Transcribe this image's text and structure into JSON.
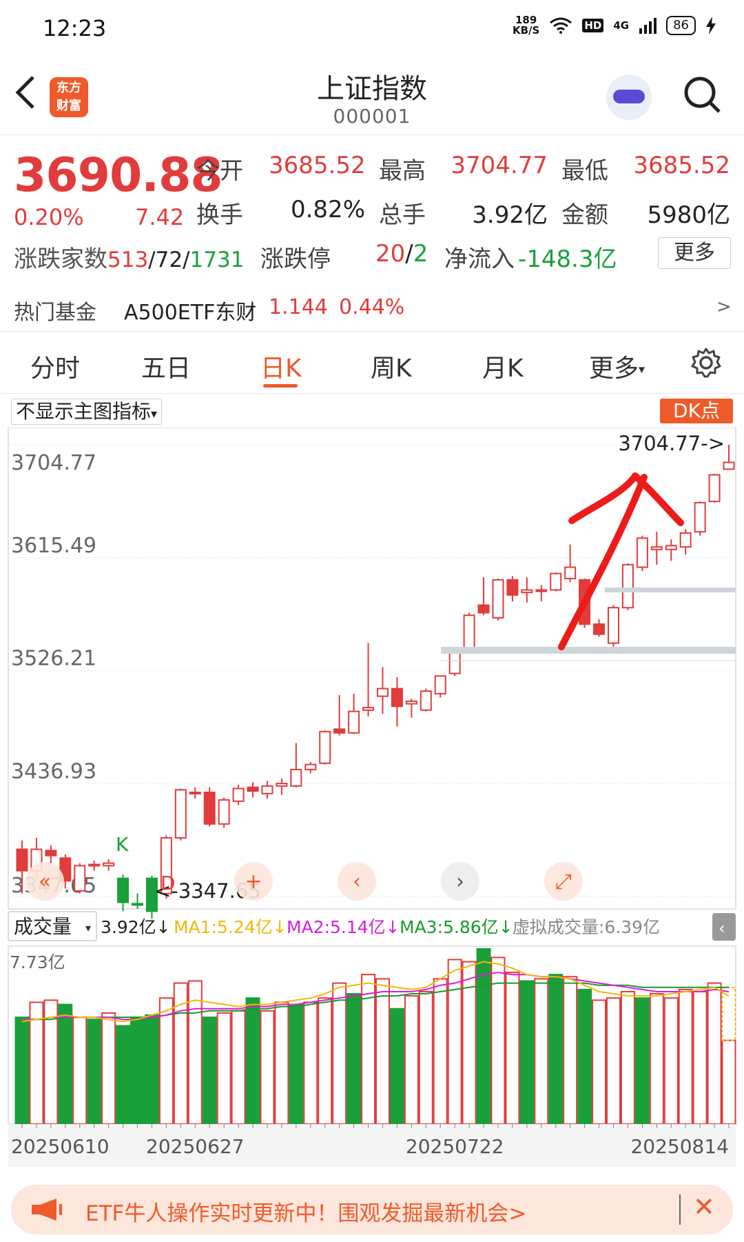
{
  "status_bar": {
    "time": "12:23",
    "speed": "189",
    "speed_unit": "KB/S",
    "hd": "HD",
    "net": "4G",
    "battery": "86"
  },
  "header": {
    "title": "上证指数",
    "code": "000001",
    "logo_line1": "东方",
    "logo_line2": "财富"
  },
  "quote": {
    "price": "3690.88",
    "change_pct": "0.20%",
    "change": "7.42",
    "rows": [
      [
        {
          "label": "今开",
          "value": "3685.52",
          "color": "red"
        },
        {
          "label": "最高",
          "value": "3704.77",
          "color": "red"
        },
        {
          "label": "最低",
          "value": "3685.52",
          "color": "red"
        }
      ],
      [
        {
          "label": "换手",
          "value": "0.82%",
          "color": "black"
        },
        {
          "label": "总手",
          "value": "3.92亿",
          "color": "black"
        },
        {
          "label": "金额",
          "value": "5980亿",
          "color": "black"
        }
      ]
    ],
    "breadth_label": "涨跌家数",
    "breadth_up": "513",
    "breadth_flat": "72",
    "breadth_down": "1731",
    "limit_label": "涨跌停",
    "limit_up": "20",
    "limit_down": "2",
    "netflow_label": "净流入",
    "netflow_value": "-148.3亿",
    "more_label": "更多"
  },
  "fund": {
    "label": "热门基金",
    "name": "A500ETF东财",
    "price": "1.144",
    "pct": "0.44%",
    "arrow": ">"
  },
  "tabs": [
    "分时",
    "五日",
    "日K",
    "周K",
    "月K",
    "更多"
  ],
  "active_tab": 2,
  "chart_toolbar": {
    "indicator_select": "不显示主图指标",
    "dk_label": "DK点"
  },
  "chart_data": [
    {
      "type": "candlestick",
      "title": "",
      "y_ticks": [
        "3704.77",
        "3615.49",
        "3526.21",
        "3436.93",
        "3347.65"
      ],
      "ylim": [
        3347.65,
        3704.77
      ],
      "high_label": "3704.77->",
      "low_label": "<-3347.65",
      "markers": [
        {
          "text": "K"
        },
        {
          "text": "D"
        }
      ],
      "candles": [
        {
          "o": 3385,
          "c": 3368,
          "h": 3392,
          "l": 3350
        },
        {
          "o": 3368,
          "c": 3385,
          "h": 3394,
          "l": 3362
        },
        {
          "o": 3384,
          "c": 3380,
          "h": 3388,
          "l": 3374
        },
        {
          "o": 3378,
          "c": 3360,
          "h": 3381,
          "l": 3354
        },
        {
          "o": 3352,
          "c": 3372,
          "h": 3374,
          "l": 3350
        },
        {
          "o": 3372,
          "c": 3373,
          "h": 3376,
          "l": 3368
        },
        {
          "o": 3372,
          "c": 3374,
          "h": 3377,
          "l": 3368
        },
        {
          "o": 3362,
          "c": 3343,
          "h": 3365,
          "l": 3336
        },
        {
          "o": 3342,
          "c": 3342,
          "h": 3350,
          "l": 3338
        },
        {
          "o": 3336,
          "c": 3362,
          "h": 3364,
          "l": 3330
        },
        {
          "o": 3350,
          "c": 3394,
          "h": 3396,
          "l": 3346
        },
        {
          "o": 3394,
          "c": 3432,
          "h": 3433,
          "l": 3392
        },
        {
          "o": 3430,
          "c": 3429,
          "h": 3434,
          "l": 3425
        },
        {
          "o": 3430,
          "c": 3405,
          "h": 3434,
          "l": 3403
        },
        {
          "o": 3405,
          "c": 3424,
          "h": 3426,
          "l": 3402
        },
        {
          "o": 3423,
          "c": 3433,
          "h": 3436,
          "l": 3420
        },
        {
          "o": 3434,
          "c": 3431,
          "h": 3438,
          "l": 3426
        },
        {
          "o": 3429,
          "c": 3435,
          "h": 3439,
          "l": 3425
        },
        {
          "o": 3435,
          "c": 3437,
          "h": 3441,
          "l": 3428
        },
        {
          "o": 3435,
          "c": 3448,
          "h": 3469,
          "l": 3434
        },
        {
          "o": 3448,
          "c": 3452,
          "h": 3454,
          "l": 3445
        },
        {
          "o": 3453,
          "c": 3478,
          "h": 3479,
          "l": 3452
        },
        {
          "o": 3480,
          "c": 3477,
          "h": 3507,
          "l": 3475
        },
        {
          "o": 3477,
          "c": 3494,
          "h": 3508,
          "l": 3476
        },
        {
          "o": 3495,
          "c": 3497,
          "h": 3548,
          "l": 3490
        },
        {
          "o": 3506,
          "c": 3512,
          "h": 3529,
          "l": 3492
        },
        {
          "o": 3512,
          "c": 3498,
          "h": 3521,
          "l": 3482
        },
        {
          "o": 3500,
          "c": 3502,
          "h": 3504,
          "l": 3489
        },
        {
          "o": 3495,
          "c": 3510,
          "h": 3512,
          "l": 3494
        },
        {
          "o": 3508,
          "c": 3522,
          "h": 3522,
          "l": 3505
        },
        {
          "o": 3524,
          "c": 3544,
          "h": 3545,
          "l": 3522
        },
        {
          "o": 3544,
          "c": 3570,
          "h": 3572,
          "l": 3541
        },
        {
          "o": 3578,
          "c": 3572,
          "h": 3600,
          "l": 3570
        },
        {
          "o": 3568,
          "c": 3598,
          "h": 3599,
          "l": 3566
        },
        {
          "o": 3598,
          "c": 3586,
          "h": 3601,
          "l": 3581
        },
        {
          "o": 3588,
          "c": 3590,
          "h": 3600,
          "l": 3580
        },
        {
          "o": 3589,
          "c": 3590,
          "h": 3594,
          "l": 3581
        },
        {
          "o": 3590,
          "c": 3603,
          "h": 3604,
          "l": 3589
        },
        {
          "o": 3599,
          "c": 3608,
          "h": 3626,
          "l": 3596
        },
        {
          "o": 3598,
          "c": 3563,
          "h": 3599,
          "l": 3560
        },
        {
          "o": 3563,
          "c": 3555,
          "h": 3567,
          "l": 3553
        },
        {
          "o": 3548,
          "c": 3576,
          "h": 3578,
          "l": 3545
        },
        {
          "o": 3576,
          "c": 3610,
          "h": 3611,
          "l": 3574
        },
        {
          "o": 3608,
          "c": 3631,
          "h": 3633,
          "l": 3605
        },
        {
          "o": 3622,
          "c": 3624,
          "h": 3636,
          "l": 3610
        },
        {
          "o": 3622,
          "c": 3625,
          "h": 3630,
          "l": 3613
        },
        {
          "o": 3624,
          "c": 3635,
          "h": 3638,
          "l": 3618
        },
        {
          "o": 3636,
          "c": 3659,
          "h": 3660,
          "l": 3633
        },
        {
          "o": 3660,
          "c": 3681,
          "h": 3682,
          "l": 3659
        },
        {
          "o": 3685.52,
          "c": 3690.88,
          "h": 3704.77,
          "l": 3685.52
        }
      ]
    },
    {
      "type": "bar",
      "title": "成交量",
      "ylabel": "7.73亿",
      "ylim": [
        0,
        7.73
      ],
      "legend": {
        "current": "3.92亿↓",
        "ma1": "MA1:5.24亿↓",
        "ma2": "MA2:5.14亿↓",
        "ma3": "MA3:5.86亿↓",
        "virtual": "虚拟成交量:6.39亿"
      },
      "x_labels": [
        "20250610",
        "20250627",
        "20250722",
        "20250814"
      ],
      "bar_colors": {
        "up": "#e23b3b",
        "down": "#19a03a"
      },
      "values": [
        5.0,
        5.7,
        5.8,
        5.6,
        5.0,
        4.9,
        5.2,
        4.6,
        5.0,
        5.1,
        5.9,
        6.6,
        6.7,
        5.0,
        5.2,
        5.3,
        5.9,
        5.3,
        5.7,
        5.6,
        5.7,
        5.9,
        6.6,
        6.1,
        7.0,
        6.8,
        5.4,
        6.0,
        6.2,
        6.8,
        7.7,
        7.6,
        8.2,
        7.8,
        7.1,
        6.7,
        6.8,
        7.0,
        6.9,
        6.3,
        5.8,
        5.9,
        6.2,
        5.9,
        6.1,
        5.9,
        6.3,
        6.2,
        6.6,
        3.92
      ],
      "ma1": [
        4.8,
        4.9,
        5.0,
        5.1,
        5.0,
        5.0,
        4.9,
        4.8,
        4.9,
        5.1,
        5.3,
        5.6,
        5.8,
        5.7,
        5.6,
        5.5,
        5.6,
        5.6,
        5.7,
        5.8,
        5.9,
        6.1,
        6.4,
        6.5,
        6.6,
        6.5,
        6.4,
        6.3,
        6.4,
        6.8,
        7.2,
        7.4,
        7.6,
        7.5,
        7.3,
        7.0,
        6.9,
        6.9,
        6.8,
        6.5,
        6.2,
        6.1,
        6.0,
        6.0,
        6.0,
        6.1,
        6.2,
        6.3,
        6.4,
        6.0
      ],
      "ma2": [
        4.9,
        4.9,
        5.0,
        5.0,
        5.0,
        5.0,
        5.0,
        4.9,
        4.9,
        5.0,
        5.1,
        5.3,
        5.4,
        5.4,
        5.4,
        5.4,
        5.5,
        5.5,
        5.6,
        5.6,
        5.7,
        5.8,
        5.9,
        6.0,
        6.1,
        6.2,
        6.2,
        6.2,
        6.3,
        6.5,
        6.6,
        6.8,
        7.0,
        7.1,
        7.0,
        7.0,
        6.9,
        6.9,
        6.8,
        6.7,
        6.6,
        6.5,
        6.4,
        6.3,
        6.2,
        6.2,
        6.2,
        6.2,
        6.3,
        6.2
      ],
      "ma3": [
        4.9,
        4.9,
        4.9,
        5.0,
        5.0,
        5.0,
        5.0,
        5.0,
        5.0,
        5.0,
        5.1,
        5.2,
        5.2,
        5.3,
        5.3,
        5.3,
        5.4,
        5.4,
        5.5,
        5.5,
        5.6,
        5.7,
        5.8,
        5.8,
        5.9,
        6.0,
        6.0,
        6.1,
        6.1,
        6.2,
        6.3,
        6.4,
        6.5,
        6.6,
        6.6,
        6.6,
        6.6,
        6.6,
        6.6,
        6.6,
        6.5,
        6.5,
        6.5,
        6.4,
        6.4,
        6.4,
        6.4,
        6.4,
        6.4,
        6.4
      ],
      "colors": {
        "ma1": "#f2b705",
        "ma2": "#d81ed8",
        "ma3": "#189a2c"
      }
    }
  ],
  "chart_controls": {
    "tools": [
      "«",
      "+",
      "‹",
      "›",
      "⤢"
    ]
  },
  "banner": {
    "text": "ETF牛人操作实时更新中！围观发掘最新机会>",
    "close": "✕"
  }
}
